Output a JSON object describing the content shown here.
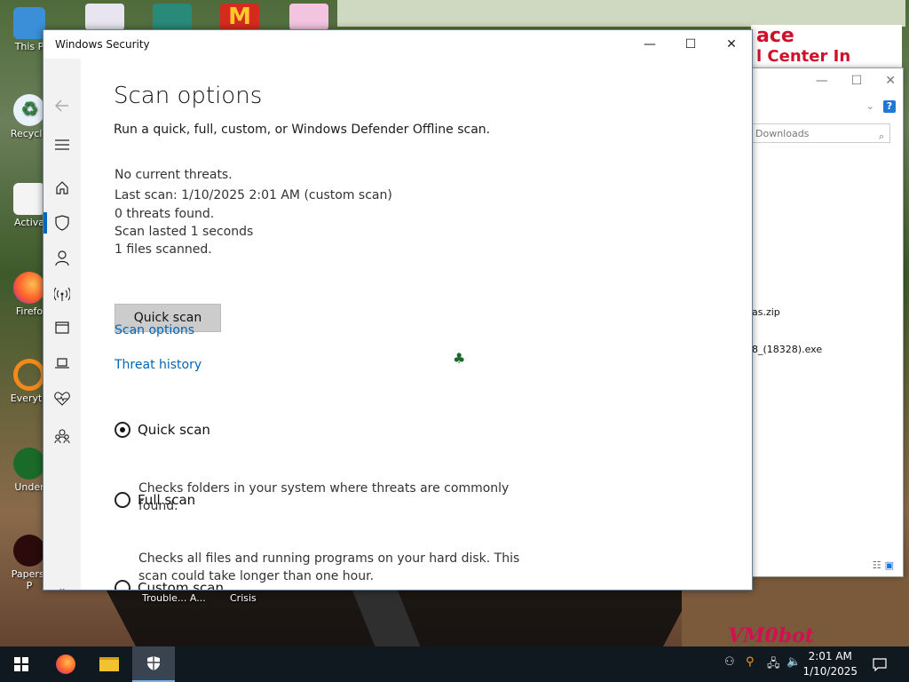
{
  "desktop": {
    "icons": [
      {
        "label": "This P"
      },
      {
        "label": "Recycle"
      },
      {
        "label": "Activa"
      },
      {
        "label": "Firefo"
      },
      {
        "label": "Everyth"
      },
      {
        "label": "Under"
      },
      {
        "label": "Papers, P"
      }
    ],
    "below_window_labels": [
      "Trouble... A...",
      "Crisis"
    ],
    "banner_lines": [
      "ace",
      "l Center In"
    ],
    "watermark": "VM0bot"
  },
  "explorer": {
    "search_placeholder": "Downloads",
    "files": [
      "as.zip",
      "8_(18328).exe"
    ],
    "help_label": "?"
  },
  "window": {
    "title": "Windows Security",
    "back_icon": "back-arrow-icon"
  },
  "content": {
    "heading": "Scan options",
    "subtitle": "Run a quick, full, custom, or Windows Defender Offline scan.",
    "status": {
      "no_threats": "No current threats.",
      "last_scan": "Last scan: 1/10/2025 2:01 AM (custom scan)",
      "threats_found": "0 threats found.",
      "duration": "Scan lasted 1 seconds",
      "files_scanned": "1 files scanned."
    },
    "quick_scan_button": "Quick scan",
    "links": {
      "scan_options": "Scan options",
      "threat_history": "Threat history"
    },
    "options": [
      {
        "label": "Quick scan",
        "selected": true,
        "description": "Checks folders in your system where threats are commonly found."
      },
      {
        "label": "Full scan",
        "selected": false,
        "description": "Checks all files and running programs on your hard disk. This scan could take longer than one hour."
      },
      {
        "label": "Custom scan",
        "selected": false,
        "description": ""
      }
    ]
  },
  "taskbar": {
    "time": "2:01 AM",
    "date": "1/10/2025"
  },
  "colors": {
    "accent": "#0067c0",
    "link": "#0067b8",
    "taskbar": "#101820"
  }
}
